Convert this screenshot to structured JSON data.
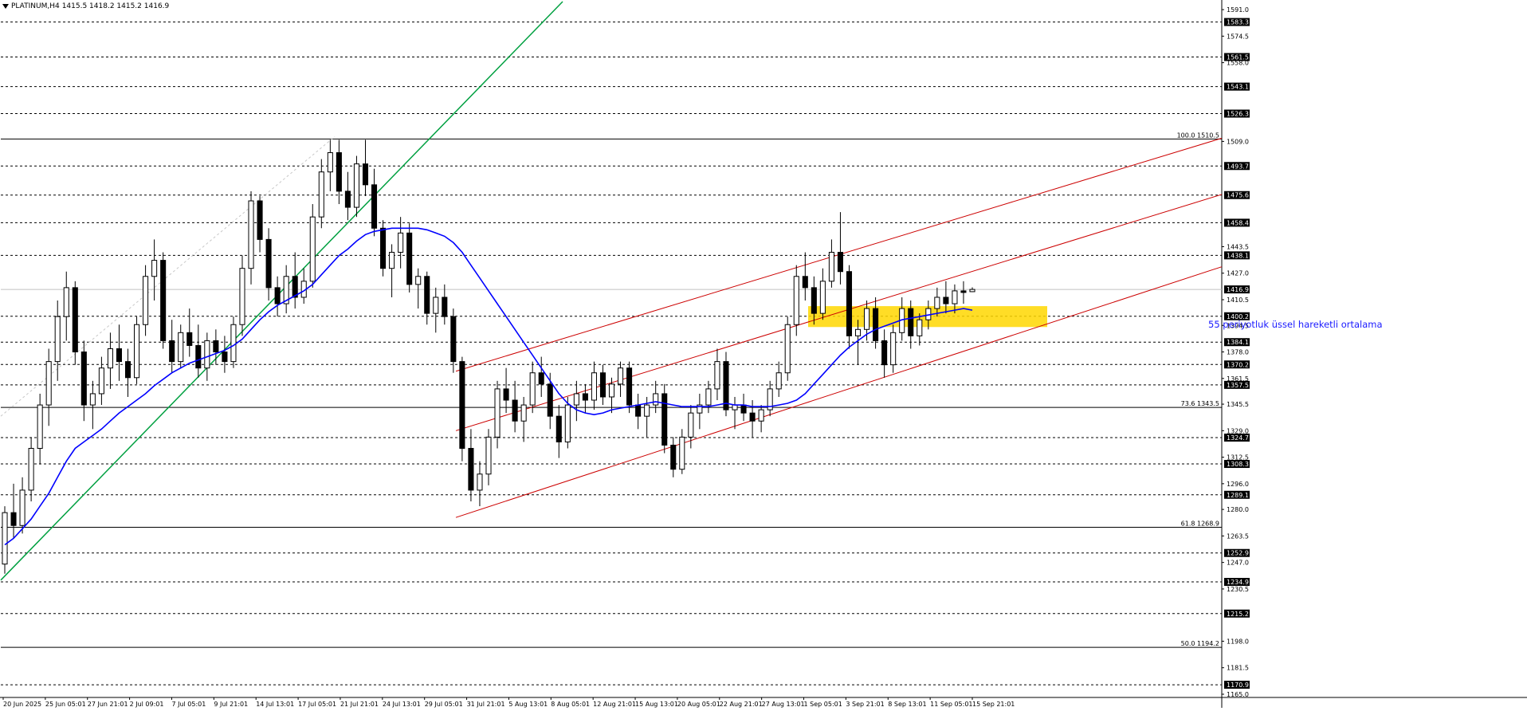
{
  "header": {
    "symbol": "PLATINUM,H4",
    "ohlc": "1415.5 1418.2 1415.2 1416.9"
  },
  "annotation": "55 periyotluk üssel hareketli ortalama",
  "colors": {
    "background": "#ffffff",
    "candle": "#000000",
    "ema": "#0000ff",
    "up_trendline": "#00a040",
    "channel": "#cc0000",
    "zone": "#ffd700",
    "level_line": "#000000"
  },
  "chart_data": {
    "type": "candlestick",
    "symbol": "PLATINUM",
    "timeframe": "H4",
    "ylim": [
      1163,
      1596
    ],
    "y_ticks": [
      1591.0,
      1574.5,
      1558.0,
      1509.0,
      1443.5,
      1427.0,
      1410.5,
      1394.5,
      1378.0,
      1361.5,
      1345.5,
      1329.0,
      1312.5,
      1296.0,
      1280.0,
      1263.5,
      1247.0,
      1230.5,
      1198.0,
      1181.5,
      1165.0
    ],
    "x_labels": [
      "20 Jun 2025",
      "25 Jun 05:01",
      "27 Jun 21:01",
      "2 Jul 09:01",
      "7 Jul 05:01",
      "9 Jul 21:01",
      "14 Jul 13:01",
      "17 Jul 05:01",
      "21 Jul 21:01",
      "24 Jul 13:01",
      "29 Jul 05:01",
      "31 Jul 21:01",
      "5 Aug 13:01",
      "8 Aug 05:01",
      "12 Aug 21:01",
      "15 Aug 13:01",
      "20 Aug 05:01",
      "22 Aug 21:01",
      "27 Aug 13:01",
      "1 Sep 05:01",
      "3 Sep 21:01",
      "8 Sep 13:01",
      "11 Sep 05:01",
      "15 Sep 21:01"
    ],
    "dashed_levels": [
      1583.3,
      1561.5,
      1543.1,
      1526.3,
      1493.7,
      1475.6,
      1458.4,
      1438.1,
      1400.2,
      1384.1,
      1370.2,
      1357.5,
      1324.7,
      1308.3,
      1289.1,
      1252.9,
      1234.9,
      1215.2,
      1170.9
    ],
    "current_price": 1416.9,
    "fibonacci": [
      {
        "label": "100.0 1510.5",
        "value": 1510.5
      },
      {
        "label": "73.6 1343.5",
        "value": 1343.5
      },
      {
        "label": "61.8 1268.9",
        "value": 1268.9
      },
      {
        "label": "50.0 1194.2",
        "value": 1194.2
      }
    ],
    "support_zone": {
      "low": 1393.5,
      "high": 1406.5
    },
    "candles": [
      [
        1246,
        1282,
        1240,
        1278
      ],
      [
        1278,
        1296,
        1262,
        1270
      ],
      [
        1270,
        1300,
        1265,
        1292
      ],
      [
        1292,
        1325,
        1285,
        1318
      ],
      [
        1318,
        1352,
        1308,
        1345
      ],
      [
        1345,
        1380,
        1332,
        1372
      ],
      [
        1372,
        1410,
        1360,
        1400
      ],
      [
        1400,
        1428,
        1385,
        1418
      ],
      [
        1418,
        1422,
        1370,
        1378
      ],
      [
        1378,
        1385,
        1335,
        1345
      ],
      [
        1345,
        1360,
        1330,
        1352
      ],
      [
        1352,
        1375,
        1345,
        1368
      ],
      [
        1368,
        1390,
        1355,
        1380
      ],
      [
        1380,
        1395,
        1360,
        1372
      ],
      [
        1372,
        1380,
        1350,
        1362
      ],
      [
        1362,
        1400,
        1358,
        1395
      ],
      [
        1395,
        1432,
        1388,
        1425
      ],
      [
        1425,
        1448,
        1410,
        1435
      ],
      [
        1435,
        1440,
        1380,
        1385
      ],
      [
        1385,
        1398,
        1365,
        1372
      ],
      [
        1372,
        1395,
        1368,
        1390
      ],
      [
        1390,
        1405,
        1375,
        1382
      ],
      [
        1382,
        1395,
        1362,
        1368
      ],
      [
        1368,
        1390,
        1360,
        1385
      ],
      [
        1385,
        1392,
        1370,
        1378
      ],
      [
        1378,
        1388,
        1365,
        1372
      ],
      [
        1372,
        1400,
        1368,
        1395
      ],
      [
        1395,
        1438,
        1388,
        1430
      ],
      [
        1430,
        1478,
        1420,
        1472
      ],
      [
        1472,
        1475,
        1440,
        1448
      ],
      [
        1448,
        1455,
        1410,
        1418
      ],
      [
        1418,
        1425,
        1400,
        1408
      ],
      [
        1408,
        1432,
        1402,
        1425
      ],
      [
        1425,
        1440,
        1405,
        1412
      ],
      [
        1412,
        1430,
        1408,
        1422
      ],
      [
        1422,
        1470,
        1418,
        1462
      ],
      [
        1462,
        1498,
        1455,
        1490
      ],
      [
        1490,
        1510,
        1478,
        1502
      ],
      [
        1502,
        1510,
        1470,
        1478
      ],
      [
        1478,
        1490,
        1460,
        1468
      ],
      [
        1468,
        1500,
        1462,
        1495
      ],
      [
        1495,
        1510,
        1475,
        1482
      ],
      [
        1482,
        1492,
        1450,
        1455
      ],
      [
        1455,
        1460,
        1425,
        1430
      ],
      [
        1430,
        1445,
        1412,
        1440
      ],
      [
        1440,
        1462,
        1430,
        1452
      ],
      [
        1452,
        1458,
        1415,
        1420
      ],
      [
        1420,
        1430,
        1405,
        1425
      ],
      [
        1425,
        1428,
        1395,
        1402
      ],
      [
        1402,
        1418,
        1390,
        1412
      ],
      [
        1412,
        1420,
        1395,
        1400
      ],
      [
        1400,
        1405,
        1365,
        1372
      ],
      [
        1372,
        1375,
        1310,
        1318
      ],
      [
        1318,
        1330,
        1285,
        1292
      ],
      [
        1292,
        1310,
        1282,
        1302
      ],
      [
        1302,
        1330,
        1295,
        1325
      ],
      [
        1325,
        1360,
        1318,
        1355
      ],
      [
        1355,
        1368,
        1340,
        1348
      ],
      [
        1348,
        1360,
        1328,
        1335
      ],
      [
        1335,
        1350,
        1322,
        1345
      ],
      [
        1345,
        1372,
        1340,
        1365
      ],
      [
        1365,
        1375,
        1350,
        1358
      ],
      [
        1358,
        1365,
        1330,
        1338
      ],
      [
        1338,
        1345,
        1312,
        1322
      ],
      [
        1322,
        1350,
        1318,
        1345
      ],
      [
        1345,
        1360,
        1335,
        1352
      ],
      [
        1352,
        1358,
        1340,
        1348
      ],
      [
        1348,
        1372,
        1342,
        1365
      ],
      [
        1365,
        1370,
        1345,
        1350
      ],
      [
        1350,
        1362,
        1340,
        1358
      ],
      [
        1358,
        1372,
        1350,
        1368
      ],
      [
        1368,
        1372,
        1340,
        1345
      ],
      [
        1345,
        1352,
        1330,
        1338
      ],
      [
        1338,
        1350,
        1325,
        1345
      ],
      [
        1345,
        1360,
        1340,
        1352
      ],
      [
        1352,
        1358,
        1315,
        1320
      ],
      [
        1320,
        1325,
        1300,
        1305
      ],
      [
        1305,
        1330,
        1302,
        1325
      ],
      [
        1325,
        1345,
        1318,
        1340
      ],
      [
        1340,
        1352,
        1330,
        1345
      ],
      [
        1345,
        1360,
        1340,
        1355
      ],
      [
        1355,
        1380,
        1348,
        1372
      ],
      [
        1372,
        1378,
        1338,
        1342
      ],
      [
        1342,
        1350,
        1330,
        1345
      ],
      [
        1345,
        1352,
        1335,
        1340
      ],
      [
        1340,
        1348,
        1325,
        1335
      ],
      [
        1335,
        1345,
        1328,
        1342
      ],
      [
        1342,
        1360,
        1338,
        1355
      ],
      [
        1355,
        1372,
        1350,
        1365
      ],
      [
        1365,
        1400,
        1360,
        1395
      ],
      [
        1395,
        1432,
        1388,
        1425
      ],
      [
        1425,
        1440,
        1410,
        1418
      ],
      [
        1418,
        1425,
        1395,
        1402
      ],
      [
        1402,
        1430,
        1398,
        1422
      ],
      [
        1422,
        1448,
        1418,
        1440
      ],
      [
        1440,
        1465,
        1420,
        1428
      ],
      [
        1428,
        1432,
        1380,
        1388
      ],
      [
        1388,
        1398,
        1370,
        1392
      ],
      [
        1392,
        1410,
        1385,
        1405
      ],
      [
        1405,
        1412,
        1380,
        1385
      ],
      [
        1385,
        1392,
        1362,
        1370
      ],
      [
        1370,
        1395,
        1365,
        1390
      ],
      [
        1390,
        1412,
        1385,
        1405
      ],
      [
        1405,
        1410,
        1380,
        1388
      ],
      [
        1388,
        1402,
        1382,
        1398
      ],
      [
        1398,
        1410,
        1392,
        1405
      ],
      [
        1405,
        1418,
        1400,
        1412
      ],
      [
        1412,
        1422,
        1402,
        1408
      ],
      [
        1408,
        1420,
        1402,
        1416
      ],
      [
        1416,
        1422,
        1408,
        1415
      ],
      [
        1415.5,
        1418.2,
        1415.2,
        1416.9
      ]
    ],
    "ema55": [
      1258,
      1262,
      1268,
      1274,
      1282,
      1290,
      1300,
      1310,
      1318,
      1322,
      1326,
      1330,
      1335,
      1340,
      1344,
      1348,
      1352,
      1357,
      1361,
      1365,
      1368,
      1371,
      1373,
      1375,
      1377,
      1379,
      1382,
      1386,
      1392,
      1398,
      1403,
      1407,
      1410,
      1413,
      1416,
      1420,
      1426,
      1432,
      1438,
      1442,
      1447,
      1451,
      1453,
      1454,
      1455,
      1455,
      1455,
      1455,
      1454,
      1452,
      1450,
      1446,
      1440,
      1432,
      1424,
      1416,
      1408,
      1400,
      1392,
      1384,
      1376,
      1368,
      1360,
      1352,
      1346,
      1342,
      1340,
      1339,
      1340,
      1342,
      1343,
      1344,
      1345,
      1346,
      1347,
      1346,
      1345,
      1344,
      1344,
      1344,
      1344,
      1345,
      1346,
      1345,
      1345,
      1344,
      1344,
      1344,
      1345,
      1346,
      1348,
      1352,
      1358,
      1364,
      1370,
      1376,
      1381,
      1385,
      1389,
      1392,
      1394,
      1396,
      1398,
      1399,
      1400,
      1401,
      1402,
      1403,
      1404,
      1405,
      1404
    ]
  }
}
